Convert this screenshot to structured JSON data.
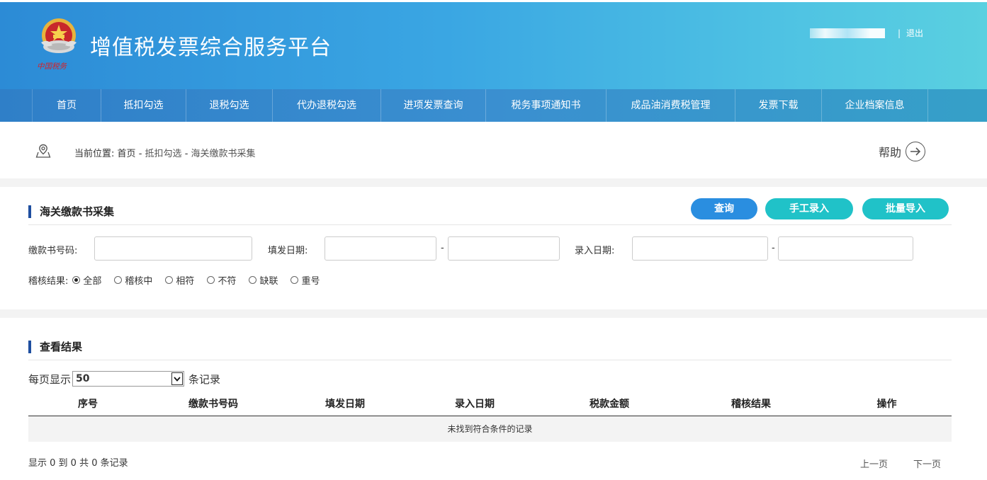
{
  "header": {
    "title": "增值税发票综合服务平台",
    "emblem_caption": "中国税务",
    "user_separator": "|",
    "logout_label": "退出"
  },
  "nav": {
    "items": [
      {
        "label": "首页"
      },
      {
        "label": "抵扣勾选"
      },
      {
        "label": "退税勾选"
      },
      {
        "label": "代办退税勾选"
      },
      {
        "label": "进项发票查询"
      },
      {
        "label": "税务事项通知书"
      },
      {
        "label": "成品油消费税管理"
      },
      {
        "label": "发票下载"
      },
      {
        "label": "企业档案信息"
      }
    ]
  },
  "breadcrumb": {
    "prefix": "当前位置:",
    "home": "首页",
    "sep1": "-",
    "level1": "抵扣勾选",
    "sep2": "-",
    "current": "海关缴款书采集",
    "help_label": "帮助"
  },
  "query_panel": {
    "title": "海关缴款书采集",
    "buttons": {
      "query": "查询",
      "manual_entry": "手工录入",
      "batch_import": "批量导入"
    },
    "fields": {
      "bill_number_label": "缴款书号码:",
      "bill_number_value": "",
      "issue_date_label": "填发日期:",
      "issue_date_from": "",
      "issue_date_to": "",
      "entry_date_label": "录入日期:",
      "entry_date_from": "",
      "entry_date_to": "",
      "range_sep": "-"
    },
    "audit": {
      "label": "稽核结果:",
      "options": [
        {
          "label": "全部",
          "checked": true
        },
        {
          "label": "稽核中",
          "checked": false
        },
        {
          "label": "相符",
          "checked": false
        },
        {
          "label": "不符",
          "checked": false
        },
        {
          "label": "缺联",
          "checked": false
        },
        {
          "label": "重号",
          "checked": false
        }
      ]
    }
  },
  "results": {
    "title": "查看结果",
    "page_size_prefix": "每页显示",
    "page_size_value": "50",
    "page_size_suffix": "条记录",
    "columns": [
      "序号",
      "缴款书号码",
      "填发日期",
      "录入日期",
      "税款金额",
      "稽核结果",
      "操作"
    ],
    "empty_message": "未找到符合条件的记录",
    "footer_info": "显示 0 到 0 共 0 条记录",
    "prev_label": "上一页",
    "next_label": "下一页"
  },
  "colors": {
    "header_gradient_start": "#2c8bd6",
    "header_gradient_end": "#5ad0e0",
    "query_button": "#2a8ee0",
    "teal_button": "#20c2c8",
    "section_bar": "#1f4fa0"
  }
}
